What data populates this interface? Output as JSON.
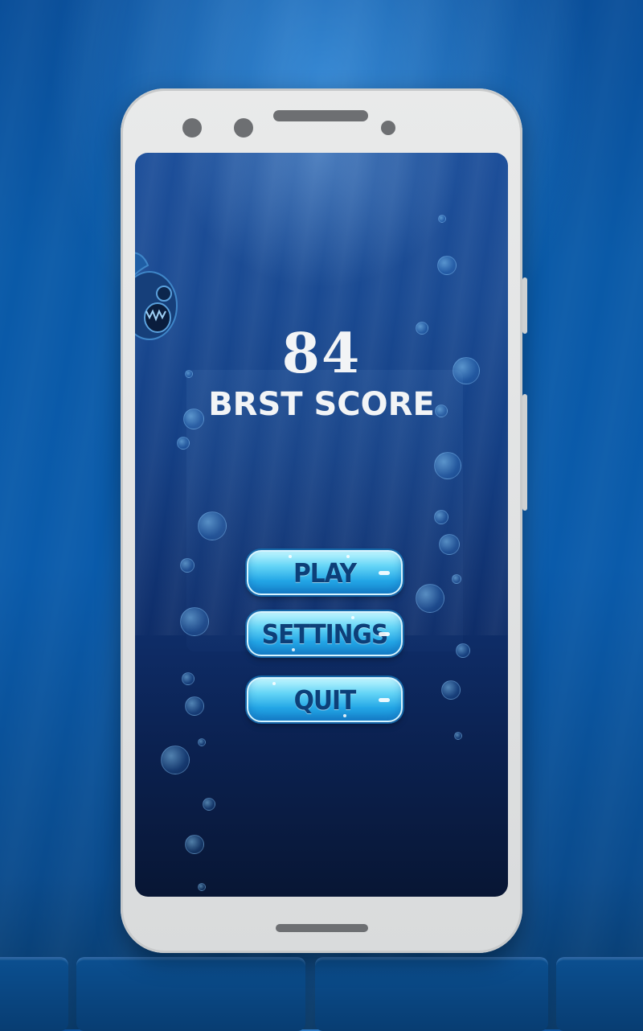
{
  "game": {
    "score": "84",
    "best_score_label": "BRST SCORE"
  },
  "menu": {
    "play_label": "PLAY",
    "settings_label": "SETTINGS",
    "quit_label": "QUIT"
  },
  "colors": {
    "background_blue": "#0a5aa8",
    "button_fill": "#23a6e6",
    "button_text": "#0d3f78",
    "phone_frame": "#e2e4e5"
  },
  "icons": {
    "mascot": "fish-icon"
  }
}
